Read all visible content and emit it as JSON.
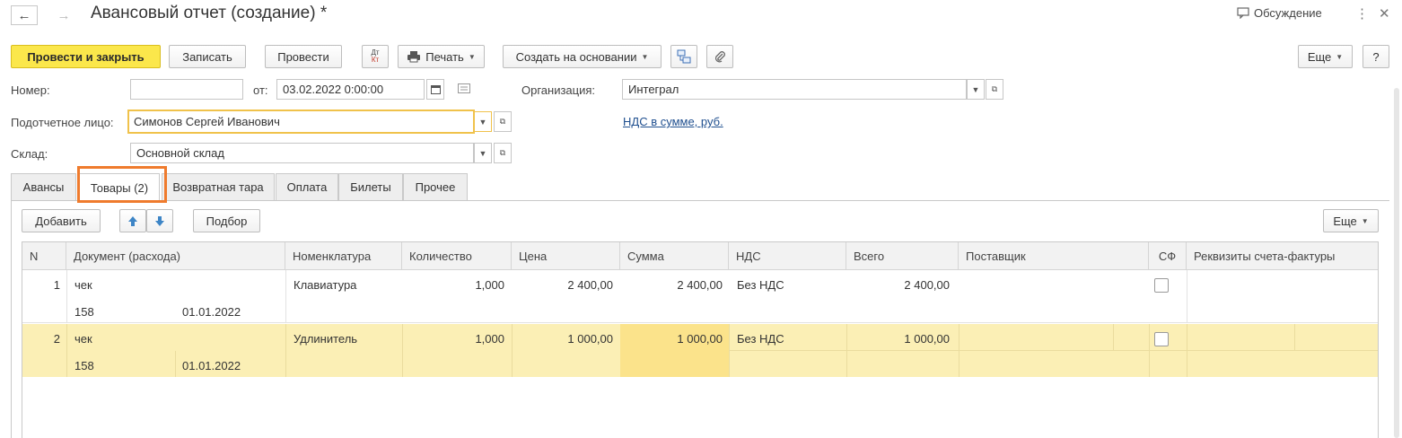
{
  "header": {
    "back_icon": "←",
    "forward_icon": "→",
    "title": "Авансовый отчет (создание) *",
    "discussion_label": "Обсуждение",
    "more_icon": "⋮",
    "close_icon": "✕"
  },
  "toolbar": {
    "post_close": "Провести и закрыть",
    "save": "Записать",
    "post": "Провести",
    "dt_kt_top": "Дт",
    "dt_kt_bottom": "Кт",
    "print": "Печать",
    "create_based": "Создать на основании",
    "more": "Еще",
    "help": "?"
  },
  "form": {
    "number_label": "Номер:",
    "number_value": "",
    "from_label": "от:",
    "date_value": "03.02.2022  0:00:00",
    "org_label": "Организация:",
    "org_value": "Интеграл",
    "person_label": "Подотчетное лицо:",
    "person_value": "Симонов Сергей  Иванович",
    "vat_link": "НДС в сумме, руб.",
    "warehouse_label": "Склад:",
    "warehouse_value": "Основной склад"
  },
  "tabs": [
    {
      "label": "Авансы"
    },
    {
      "label": "Товары (2)"
    },
    {
      "label": "Возвратная тара"
    },
    {
      "label": "Оплата"
    },
    {
      "label": "Билеты"
    },
    {
      "label": "Прочее"
    }
  ],
  "table_toolbar": {
    "add": "Добавить",
    "select": "Подбор",
    "more": "Еще"
  },
  "table": {
    "headers": [
      "N",
      "Документ (расхода)",
      "Номенклатура",
      "Количество",
      "Цена",
      "Сумма",
      "НДС",
      "Всего",
      "Поставщик",
      "СФ",
      "Реквизиты счета-фактуры"
    ],
    "rows": [
      {
        "n": "1",
        "doc": "чек",
        "doc_num": "158",
        "doc_date": "01.01.2022",
        "item": "Клавиатура",
        "qty": "1,000",
        "price": "2 400,00",
        "sum": "2 400,00",
        "vat": "Без НДС",
        "total": "2 400,00",
        "supplier": ""
      },
      {
        "n": "2",
        "doc": "чек",
        "doc_num": "158",
        "doc_date": "01.01.2022",
        "item": "Удлинитель",
        "qty": "1,000",
        "price": "1 000,00",
        "sum": "1 000,00",
        "vat": "Без НДС",
        "total": "1 000,00",
        "supplier": ""
      }
    ]
  },
  "colors": {
    "primary_button": "#fbe74b",
    "selected_row": "#fbefb5",
    "tab_highlight": "#ef7b2d",
    "link": "#1f4f8f"
  }
}
